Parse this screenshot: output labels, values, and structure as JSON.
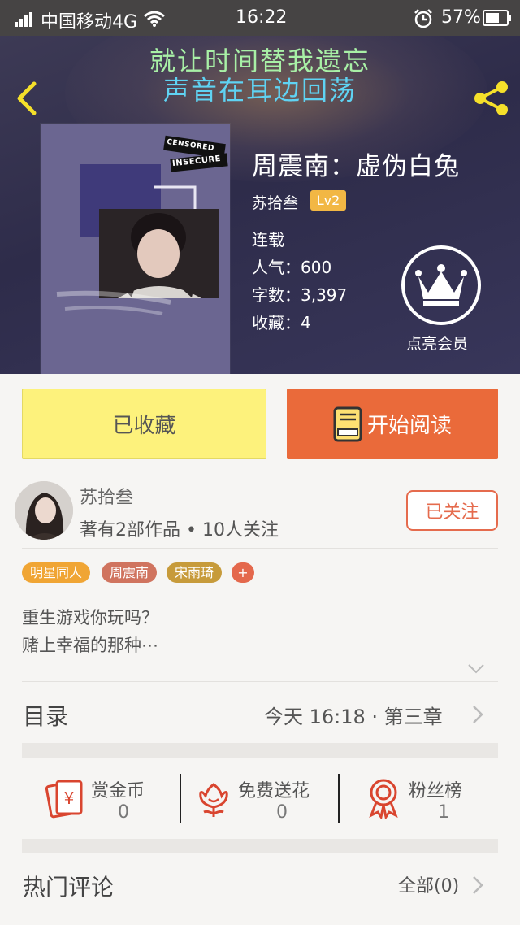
{
  "status_bar": {
    "carrier": "中国移动4G",
    "time": "16:22",
    "battery": "57%"
  },
  "header": {
    "lyric_line1": "就让时间替我遗忘",
    "lyric_line2": "声音在耳边回荡",
    "book_title": "周震南：虚伪白兔",
    "author": "苏拾叁",
    "level": "Lv2",
    "status": "连载",
    "popularity": "人气：600",
    "word_count": "字数：3,397",
    "favorites": "收藏：4",
    "vip_label": "点亮会员",
    "cover_stamp1": "CENSORED",
    "cover_stamp2": "INSECURE"
  },
  "actions": {
    "collected_label": "已收藏",
    "read_label": "开始阅读"
  },
  "author_card": {
    "name": "苏拾叁",
    "stats": "著有2部作品 • 10人关注",
    "follow_label": "已关注"
  },
  "tags": [
    {
      "label": "明星同人",
      "color": "#f0a534"
    },
    {
      "label": "周震南",
      "color": "#d0745f"
    },
    {
      "label": "宋雨琦",
      "color": "#c79b3b"
    },
    {
      "label": "+",
      "color": "#e4684c"
    }
  ],
  "description": {
    "line1": "重生游戏你玩吗？",
    "line2": "赌上幸福的那种⋯"
  },
  "toc": {
    "title": "目录",
    "latest": "今天 16:18 · 第三章"
  },
  "rewards": [
    {
      "label": "赏金币",
      "value": "0",
      "icon": "red-envelope-coin-icon"
    },
    {
      "label": "免费送花",
      "value": "0",
      "icon": "flower-icon"
    },
    {
      "label": "粉丝榜",
      "value": "1",
      "icon": "ribbon-medal-icon"
    }
  ],
  "comments": {
    "title": "热门评论",
    "all_label": "全部(0)"
  },
  "colors": {
    "accent_orange": "#ea6a3a",
    "collected_yellow": "#fdf27c",
    "icon_red": "#d9452f",
    "level_badge": "#f2b744"
  }
}
